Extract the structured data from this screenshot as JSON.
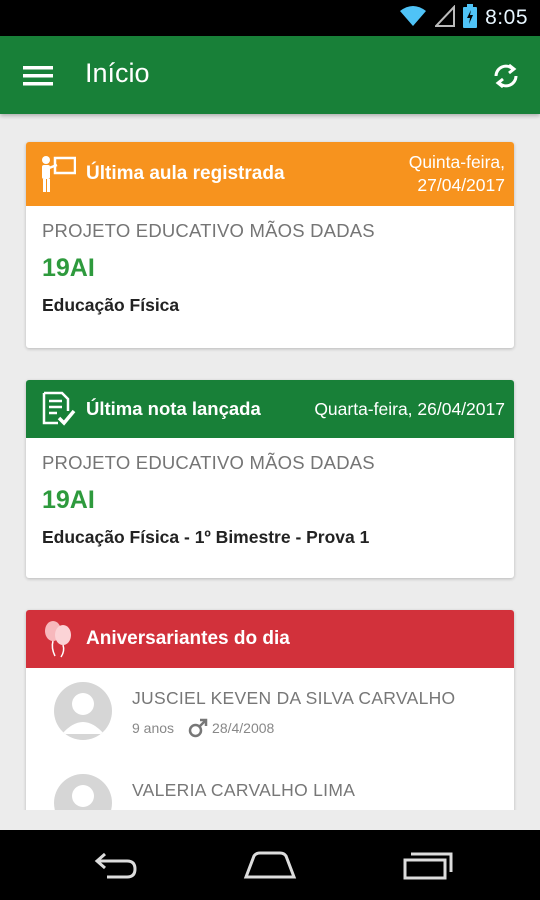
{
  "status_bar": {
    "time": "8:05",
    "icons": [
      "wifi-icon",
      "signal-icon",
      "battery-charging-icon"
    ]
  },
  "app_bar": {
    "title": "Início",
    "menu_icon": "hamburger-menu-icon",
    "refresh_icon": "refresh-icon"
  },
  "colors": {
    "primary": "#188038",
    "orange": "#f7931e",
    "red": "#d2313b",
    "class_code": "#2e9a3d"
  },
  "cards": {
    "ultima_aula": {
      "icon": "teacher-board-icon",
      "title": "Última aula registrada",
      "date_line1": "Quinta-feira,",
      "date_line2": "27/04/2017",
      "school": "PROJETO EDUCATIVO MÃOS DADAS",
      "class_code": "19AI",
      "subject": "Educação Física"
    },
    "ultima_nota": {
      "icon": "graded-document-icon",
      "title": "Última nota lançada",
      "date": "Quarta-feira, 26/04/2017",
      "school": "PROJETO EDUCATIVO MÃOS DADAS",
      "class_code": "19AI",
      "subject": "Educação Física - 1º Bimestre - Prova 1"
    },
    "aniversariantes": {
      "icon": "balloons-icon",
      "title": "Aniversariantes do dia",
      "people": [
        {
          "name": "JUSCIEL KEVEN DA SILVA CARVALHO",
          "age": "9 anos",
          "gender_icon": "male-icon",
          "birthdate": "28/4/2008"
        },
        {
          "name": "VALERIA CARVALHO LIMA"
        }
      ]
    }
  },
  "nav_bar": {
    "buttons": [
      "back-icon",
      "home-icon",
      "recent-apps-icon"
    ]
  }
}
